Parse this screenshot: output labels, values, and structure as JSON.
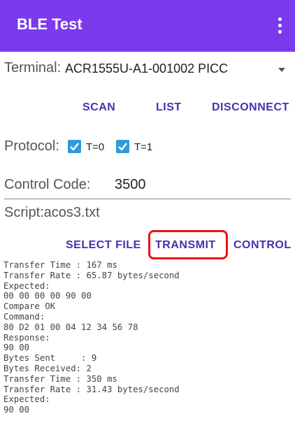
{
  "appbar": {
    "title": "BLE Test",
    "menu_icon": "more-vert-icon"
  },
  "terminal": {
    "label": "Terminal:",
    "value": "ACR1555U-A1-001002 PICC"
  },
  "connection_buttons": {
    "scan": "SCAN",
    "list": "LIST",
    "disconnect": "DISCONNECT"
  },
  "protocol": {
    "label": "Protocol:",
    "t0": {
      "label": "T=0",
      "checked": true
    },
    "t1": {
      "label": "T=1",
      "checked": true
    }
  },
  "control_code": {
    "label": "Control Code:",
    "value": "3500"
  },
  "script": {
    "label": "Script:acos3.txt"
  },
  "action_buttons": {
    "select_file": "SELECT FILE",
    "transmit": "TRANSMIT",
    "control": "CONTROL"
  },
  "colors": {
    "appbar": "#7C3AED",
    "button_text": "#4B2FB0",
    "checkbox": "#2E9BDB",
    "highlight": "#EE1111"
  },
  "log_lines": [
    "Transfer Time : 167 ms",
    "Transfer Rate : 65.87 bytes/second",
    "Expected:",
    "00 00 00 00 90 00",
    "Compare OK",
    "Command:",
    "80 D2 01 00 04 12 34 56 78",
    "Response:",
    "90 00",
    "Bytes Sent     : 9",
    "Bytes Received: 2",
    "Transfer Time : 350 ms",
    "Transfer Rate : 31.43 bytes/second",
    "Expected:",
    "90 00"
  ]
}
